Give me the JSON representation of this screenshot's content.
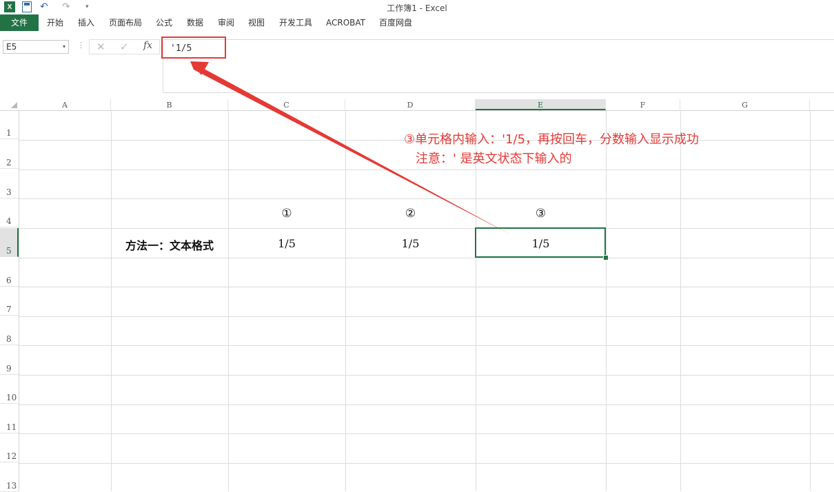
{
  "window": {
    "title": "工作簿1 - Excel",
    "app_icon_glyph": "X",
    "undo_glyph": "↶",
    "redo_glyph": "↷",
    "qat_more_glyph": "▾"
  },
  "ribbon": {
    "tabs": [
      "文件",
      "开始",
      "插入",
      "页面布局",
      "公式",
      "数据",
      "审阅",
      "视图",
      "开发工具",
      "ACROBAT",
      "百度网盘"
    ]
  },
  "formula_bar": {
    "name_box": "E5",
    "name_box_arrow": "▾",
    "dots": "⋮",
    "cancel_glyph": "✕",
    "enter_glyph": "✓",
    "fx_label": "fx",
    "formula": "'1/5"
  },
  "sheet": {
    "columns": [
      "A",
      "B",
      "C",
      "D",
      "E",
      "F",
      "G"
    ],
    "rows": [
      "1",
      "2",
      "3",
      "4",
      "5",
      "6",
      "7",
      "8",
      "9",
      "10",
      "11",
      "12",
      "13"
    ],
    "active_cell": "E5",
    "cells": {
      "C4": "①",
      "D4": "②",
      "E4": "③",
      "B5": "方法一：文本格式",
      "C5": "1/5",
      "D5": "1/5",
      "E5": "1/5"
    }
  },
  "annotation": {
    "line1": "③单元格内输入：'1/5，再按回车，分数输入显示成功",
    "line2": "注意：' 是英文状态下输入的",
    "color": "#e53935"
  },
  "colors": {
    "excel_green": "#217346",
    "annotation_red": "#e53935"
  }
}
